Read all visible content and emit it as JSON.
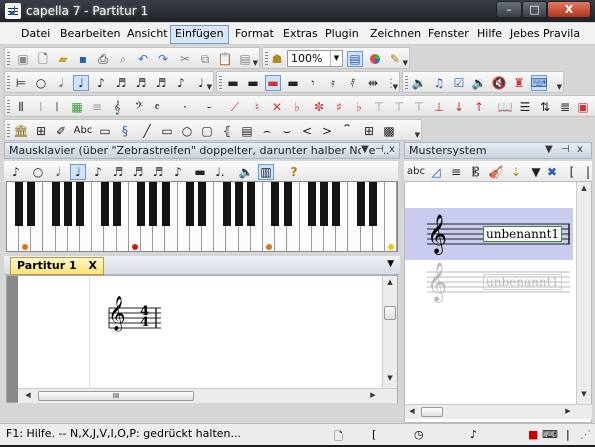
{
  "window": {
    "title": "capella 7 - Partitur 1",
    "controls": {
      "minimize": "–",
      "maximize": "□",
      "close": "X"
    }
  },
  "menu": [
    "Datei",
    "Bearbeiten",
    "Ansicht",
    "Einfügen",
    "Format",
    "Extras",
    "Plugin",
    "Zeichnen",
    "Fenster",
    "Hilfe",
    "Jebes Pravila"
  ],
  "menu_active": "Einfügen",
  "toolbar": {
    "zoom_value": "100%"
  },
  "mausklavier": {
    "title": "Mausklavier (über \"Zebrastreifen\" doppelter, darunter halber Noten...",
    "help_symbol": "?"
  },
  "mustersystem": {
    "title": "Mustersystem",
    "tool_abc": "abc",
    "entry_label": "unbenannt1",
    "ghost_label": "unbenannt1"
  },
  "document": {
    "tab_label": "Partitur 1",
    "tab_close": "X",
    "time_signature_top": "4",
    "time_signature_bottom": "4",
    "hscroll_grip": "III"
  },
  "panel_controls": {
    "dropdown": "▼",
    "pin": "⊣",
    "close": "x"
  },
  "statusbar": {
    "text": "F1: Hilfe. -- N,X,J,V,I,O,P: gedrückt halten..."
  },
  "keyboard": {
    "white_key_count": 32,
    "marker_colors": [
      "#d9781a",
      "#cc1a1a",
      "#d9781a",
      "#e8c81a"
    ]
  }
}
